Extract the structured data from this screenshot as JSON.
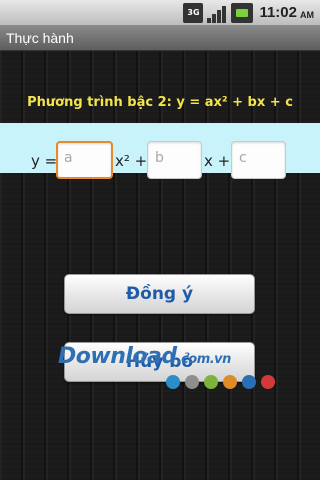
{
  "status_bar": {
    "network_label": "3G",
    "time": "11:02",
    "ampm": "AM",
    "battery_color": "#7ad13b"
  },
  "app": {
    "title": "Thực hành"
  },
  "equation": {
    "title": "Phương trình bậc 2: y = ax² + bx + c",
    "prefix": "y =",
    "after_a": "x² +",
    "after_b": "x +",
    "fields": [
      {
        "placeholder": "a",
        "focused": true
      },
      {
        "placeholder": "b",
        "focused": false
      },
      {
        "placeholder": "c",
        "focused": false
      }
    ]
  },
  "buttons": {
    "agree": "Đồng ý",
    "cancel": "Hủy bỏ"
  },
  "watermark": {
    "brand": "Download",
    "suffix": ".com.vn",
    "dot_colors": [
      "#2a8fc9",
      "#8e8e8e",
      "#7bb33b",
      "#e08a2a",
      "#2a6fb3",
      "#d23a3a"
    ]
  },
  "colors": {
    "title_yellow": "#f2e44a",
    "input_band": "#c9f3fb",
    "focus_orange": "#e8892b",
    "button_text": "#1e5ba8"
  }
}
